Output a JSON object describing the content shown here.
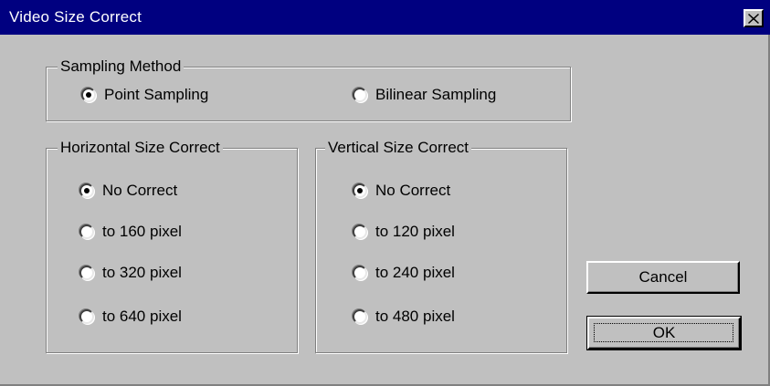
{
  "window": {
    "title": "Video Size Correct"
  },
  "sampling": {
    "legend": "Sampling Method",
    "options": [
      {
        "label": "Point Sampling",
        "checked": true
      },
      {
        "label": "Bilinear Sampling",
        "checked": false
      }
    ]
  },
  "horizontal": {
    "legend": "Horizontal Size Correct",
    "options": [
      {
        "label": "No Correct",
        "checked": true
      },
      {
        "label": "to 160 pixel",
        "checked": false
      },
      {
        "label": "to 320 pixel",
        "checked": false
      },
      {
        "label": "to 640 pixel",
        "checked": false
      }
    ]
  },
  "vertical": {
    "legend": "Vertical Size Correct",
    "options": [
      {
        "label": "No Correct",
        "checked": true
      },
      {
        "label": "to 120 pixel",
        "checked": false
      },
      {
        "label": "to 240 pixel",
        "checked": false
      },
      {
        "label": "to 480 pixel",
        "checked": false
      }
    ]
  },
  "buttons": {
    "cancel": "Cancel",
    "ok": "OK"
  },
  "colors": {
    "titlebar": "#000080",
    "face": "#c0c0c0"
  }
}
